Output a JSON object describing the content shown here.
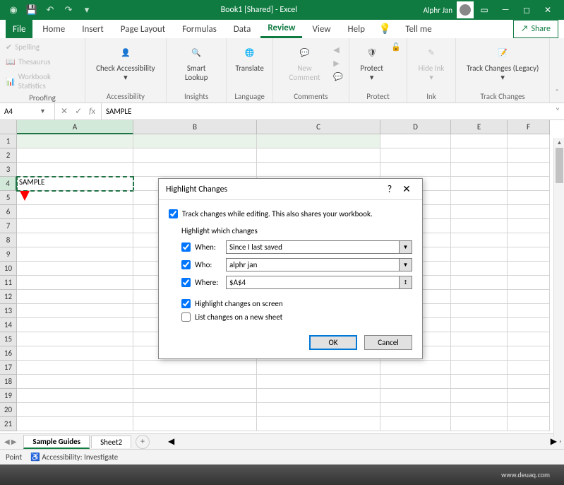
{
  "titlebar": {
    "title": "Book1 [Shared] - Excel",
    "user": "Alphr Jan"
  },
  "tabs": {
    "file": "File",
    "items": [
      "Home",
      "Insert",
      "Page Layout",
      "Formulas",
      "Data",
      "Review",
      "View",
      "Help"
    ],
    "active": "Review",
    "tell_me": "Tell me",
    "share": "Share"
  },
  "ribbon": {
    "proofing": {
      "label": "Proofing",
      "spelling": "Spelling",
      "thesaurus": "Thesaurus",
      "stats": "Workbook Statistics"
    },
    "accessibility": {
      "label": "Accessibility",
      "cmd": "Check Accessibility"
    },
    "insights": {
      "label": "Insights",
      "cmd": "Smart Lookup"
    },
    "language": {
      "label": "Language",
      "cmd": "Translate"
    },
    "comments": {
      "label": "Comments",
      "new": "New Comment"
    },
    "protect": {
      "label": "Protect",
      "cmd": "Protect"
    },
    "ink": {
      "label": "Ink",
      "cmd": "Hide Ink"
    },
    "trackchanges": {
      "label": "Track Changes",
      "cmd": "Track Changes (Legacy)"
    }
  },
  "namebox": "A4",
  "formula": "SAMPLE",
  "cols": {
    "A": 165,
    "B": 175,
    "C": 175,
    "D": 100,
    "E": 80,
    "F": 60
  },
  "rows": 21,
  "cell_a4": "SAMPLE",
  "sheets": {
    "active": "Sample Guides",
    "other": "Sheet2"
  },
  "status": {
    "point": "Point",
    "access": "Accessibility: Investigate"
  },
  "dialog": {
    "title": "Highlight Changes",
    "track_label": "Track changes while editing. This also shares your workbook.",
    "section": "Highlight which changes",
    "when_lbl": "When:",
    "when_val": "Since I last saved",
    "who_lbl": "Who:",
    "who_val": "alphr jan",
    "where_lbl": "Where:",
    "where_val": "$A$4",
    "highlight_screen": "Highlight changes on screen",
    "list_sheet": "List changes on a new sheet",
    "ok": "OK",
    "cancel": "Cancel"
  },
  "footer_url": "www.deuaq.com"
}
